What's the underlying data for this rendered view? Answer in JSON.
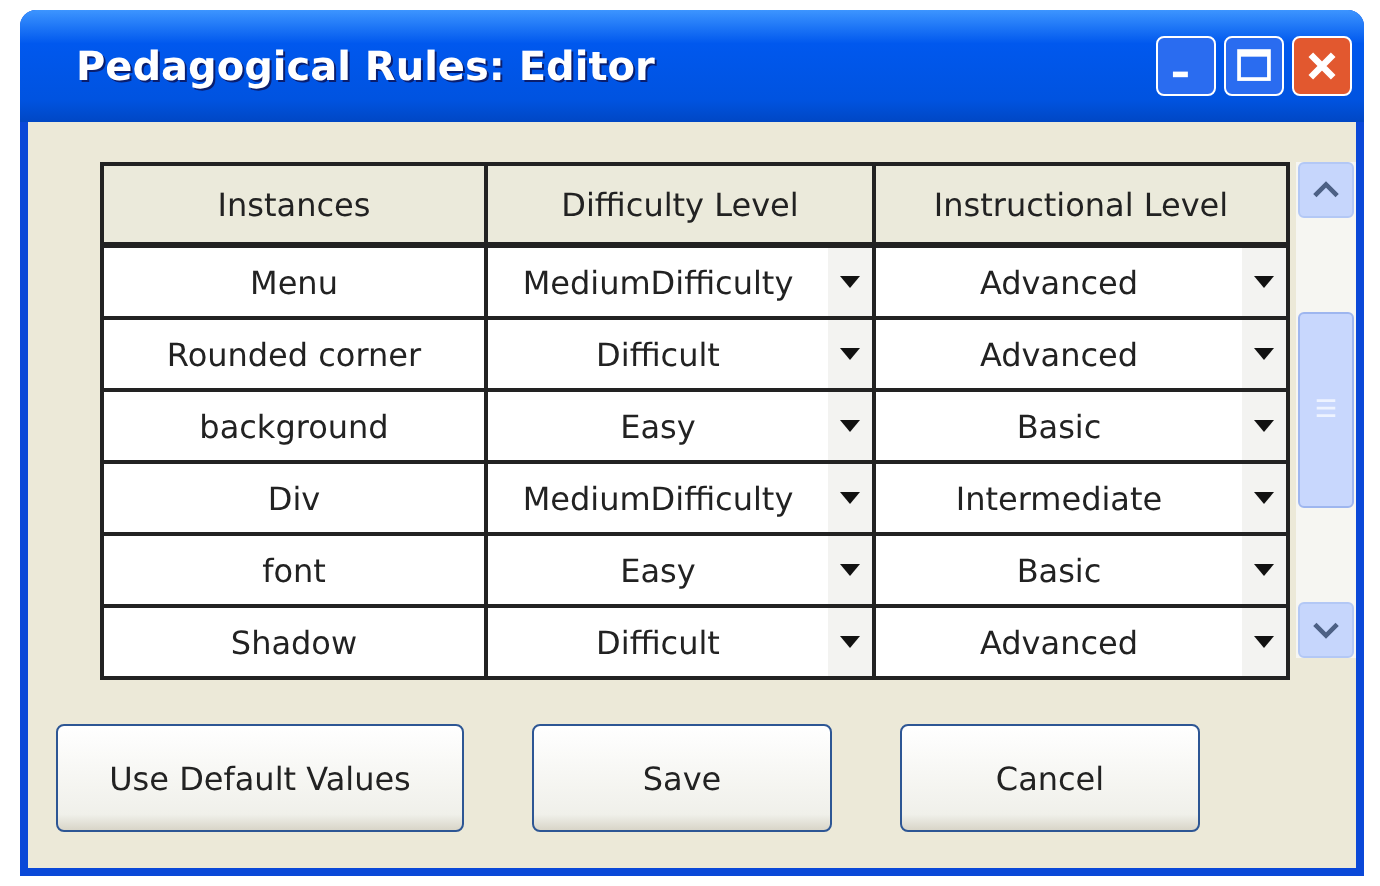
{
  "window": {
    "title": "Pedagogical Rules: Editor"
  },
  "table": {
    "columns": [
      "Instances",
      "Difficulty Level",
      "Instructional Level"
    ],
    "rows": [
      {
        "instance": "Menu",
        "difficulty": "MediumDifficulty",
        "instructional": "Advanced"
      },
      {
        "instance": "Rounded corner",
        "difficulty": "Difficult",
        "instructional": "Advanced"
      },
      {
        "instance": "background",
        "difficulty": "Easy",
        "instructional": "Basic"
      },
      {
        "instance": "Div",
        "difficulty": "MediumDifficulty",
        "instructional": "Intermediate"
      },
      {
        "instance": "font",
        "difficulty": "Easy",
        "instructional": "Basic"
      },
      {
        "instance": "Shadow",
        "difficulty": "Difficult",
        "instructional": "Advanced"
      }
    ]
  },
  "buttons": [
    "Use Default Values",
    "Save",
    "Cancel"
  ]
}
